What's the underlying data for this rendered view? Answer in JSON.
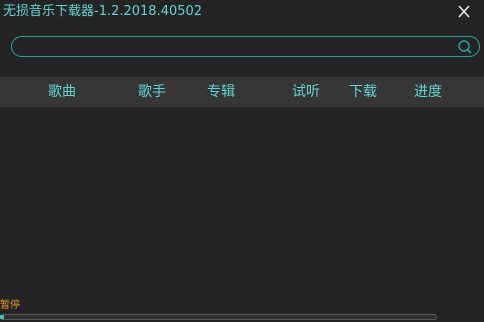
{
  "window": {
    "title": "无损音乐下载器-1.2.2018.40502"
  },
  "search": {
    "value": "",
    "placeholder": ""
  },
  "table": {
    "columns": [
      "歌曲",
      "歌手",
      "专辑",
      "试听",
      "下载",
      "进度"
    ],
    "rows": []
  },
  "status": {
    "label": "暂停",
    "progress": 0
  },
  "icons": {
    "close": "close-icon",
    "search": "search-icon"
  },
  "colors": {
    "accent": "#5ed6d0",
    "border": "#23a6a0",
    "background": "#242424",
    "header": "#363636",
    "status": "#e89a24"
  }
}
